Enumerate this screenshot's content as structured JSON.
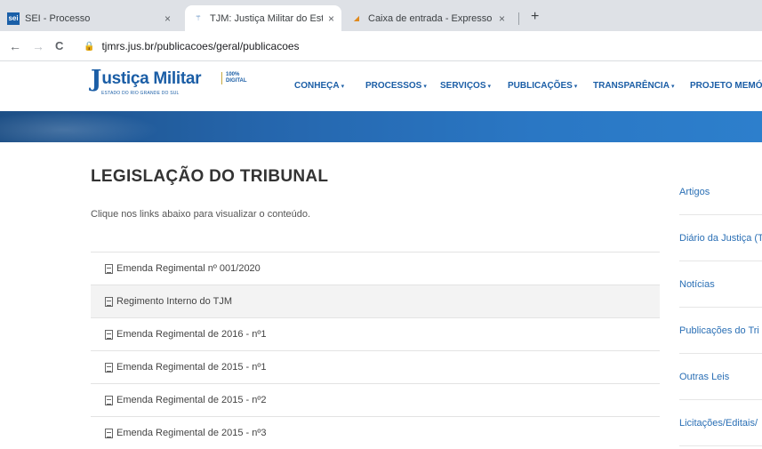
{
  "browser": {
    "tabs": [
      {
        "title": "SEI - Processo",
        "favicon": "sei",
        "close": "×"
      },
      {
        "title": "TJM: Justiça Militar do Estado do",
        "favicon": "tjm-logo",
        "close": "×"
      },
      {
        "title": "Caixa de entrada - Expresso Livre",
        "favicon": "expresso-logo",
        "close": "×"
      }
    ],
    "new_tab": "+",
    "url": "tjmrs.jus.br/publicacoes/geral/publicacoes",
    "back": "←",
    "forward": "→",
    "reload": "C",
    "lock": "🔒"
  },
  "site": {
    "logo": {
      "j": "J",
      "name": "ustiça Militar",
      "subtitle": "ESTADO DO RIO GRANDE DO SUL",
      "digital": "100% DIGITAL"
    },
    "menu": [
      "CONHEÇA",
      "PROCESSOS",
      "SERVIÇOS",
      "PUBLICAÇÕES",
      "TRANSPARÊNCIA",
      "PROJETO MEMÓR"
    ],
    "caret": "▾",
    "brand_color": "#1b5ea6"
  },
  "main": {
    "title": "LEGISLAÇÃO DO TRIBUNAL",
    "intro": "Clique nos links abaixo para visualizar o conteúdo.",
    "documents": [
      "Emenda Regimental nº 001/2020",
      "Regimento Interno do TJM",
      "Emenda Regimental de 2016 - nº1",
      "Emenda Regimental de 2015 - nº1",
      "Emenda Regimental de 2015 - nº2",
      "Emenda Regimental de 2015 - nº3"
    ]
  },
  "sidebar": {
    "items": [
      "Artigos",
      "Diário da Justiça (T",
      "Notícias",
      "Publicações do Tri",
      "Outras Leis",
      "Licitações/Editais/"
    ]
  }
}
